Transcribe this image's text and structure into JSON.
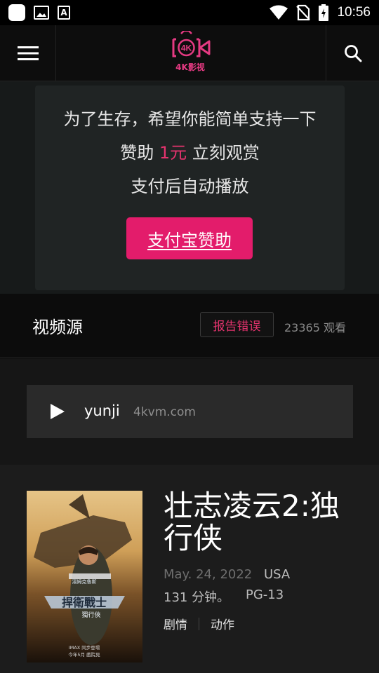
{
  "status_bar": {
    "time": "10:56",
    "icons": [
      "app-icon",
      "image-icon",
      "a-badge-icon",
      "wifi-icon",
      "no-sim-icon",
      "battery-charging-icon"
    ]
  },
  "app_bar": {
    "logo_text": "4K影视",
    "logo_badge": "4K",
    "brand_color": "#e53a82",
    "icons": [
      "menu-icon",
      "search-icon"
    ]
  },
  "donate": {
    "line1": "为了生存，希望你能简单支持一下",
    "line2_prefix": "赞助 ",
    "line2_amount": "1元",
    "line2_suffix": " 立刻观赏",
    "line3": "支付后自动播放",
    "button_label": "支付宝赞助",
    "button_color": "#e31c6b"
  },
  "source_header": {
    "title": "视频源",
    "report_label": "报告错误",
    "views": "23365 观看"
  },
  "sources": [
    {
      "name": "yunji",
      "domain": "4kvm.com"
    }
  ],
  "movie": {
    "title": "壮志凌云2:独行侠",
    "date": "May. 24, 2022",
    "country": "USA",
    "runtime": "131 分钟。",
    "rating": "PG-13",
    "genres": [
      "剧情",
      "动作"
    ],
    "poster_text": {
      "top_line": "湯姆克魯斯",
      "main": "捍衛戰士",
      "sub": "獨行俠",
      "bottom1": "IMAX 同步登場",
      "bottom2": "今年5月 戲院見"
    }
  }
}
